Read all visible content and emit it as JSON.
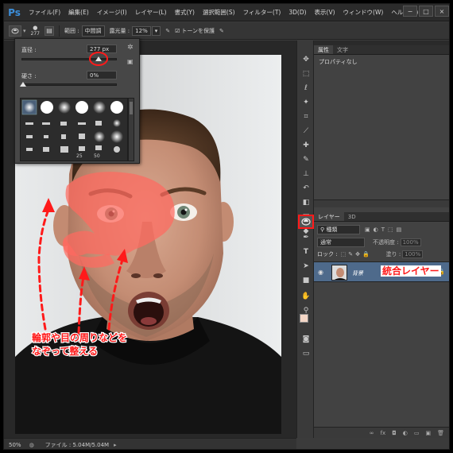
{
  "app": {
    "logo": "Ps"
  },
  "menu": [
    "ファイル(F)",
    "編集(E)",
    "イメージ(I)",
    "レイヤー(L)",
    "書式(Y)",
    "選択範囲(S)",
    "フィルター(T)",
    "3D(D)",
    "表示(V)",
    "ウィンドウ(W)",
    "ヘルプ(H)"
  ],
  "window_buttons": [
    "−",
    "□",
    "×"
  ],
  "options": {
    "brush_size": "277",
    "range_label": "範囲 :",
    "range_value": "中間調",
    "exposure_label": "露光量 :",
    "exposure_value": "12%",
    "protect_tones_label": "トーンを保護"
  },
  "brush_popup": {
    "diameter_label": "直径 :",
    "diameter_value": "277 px",
    "hardness_label": "硬さ :",
    "hardness_value": "0%",
    "preset_numbers": [
      "25",
      "50"
    ]
  },
  "properties_panel": {
    "tabs": [
      "属性",
      "文字"
    ],
    "content": "プロパティなし"
  },
  "layers_panel": {
    "tabs": [
      "レイヤー",
      "3D"
    ],
    "filter_label": "種類",
    "blend_mode": "通常",
    "opacity_label": "不透明度 :",
    "opacity_value": "100%",
    "lock_label": "ロック :",
    "fill_label": "塗り :",
    "fill_value": "100%",
    "layer_name": "背景"
  },
  "annotations": {
    "merged_layer": "統合レイヤー",
    "instruction_line1": "輪郭や目の周りなどを",
    "instruction_line2": "なぞって整える"
  },
  "status": {
    "zoom": "50%",
    "file_info": "ファイル : 5.04M/5.04M"
  },
  "colors": {
    "highlight_red": "#ff1a1a",
    "selected_layer": "#4e6a8b",
    "brush_overlay": "#ff6a60"
  }
}
